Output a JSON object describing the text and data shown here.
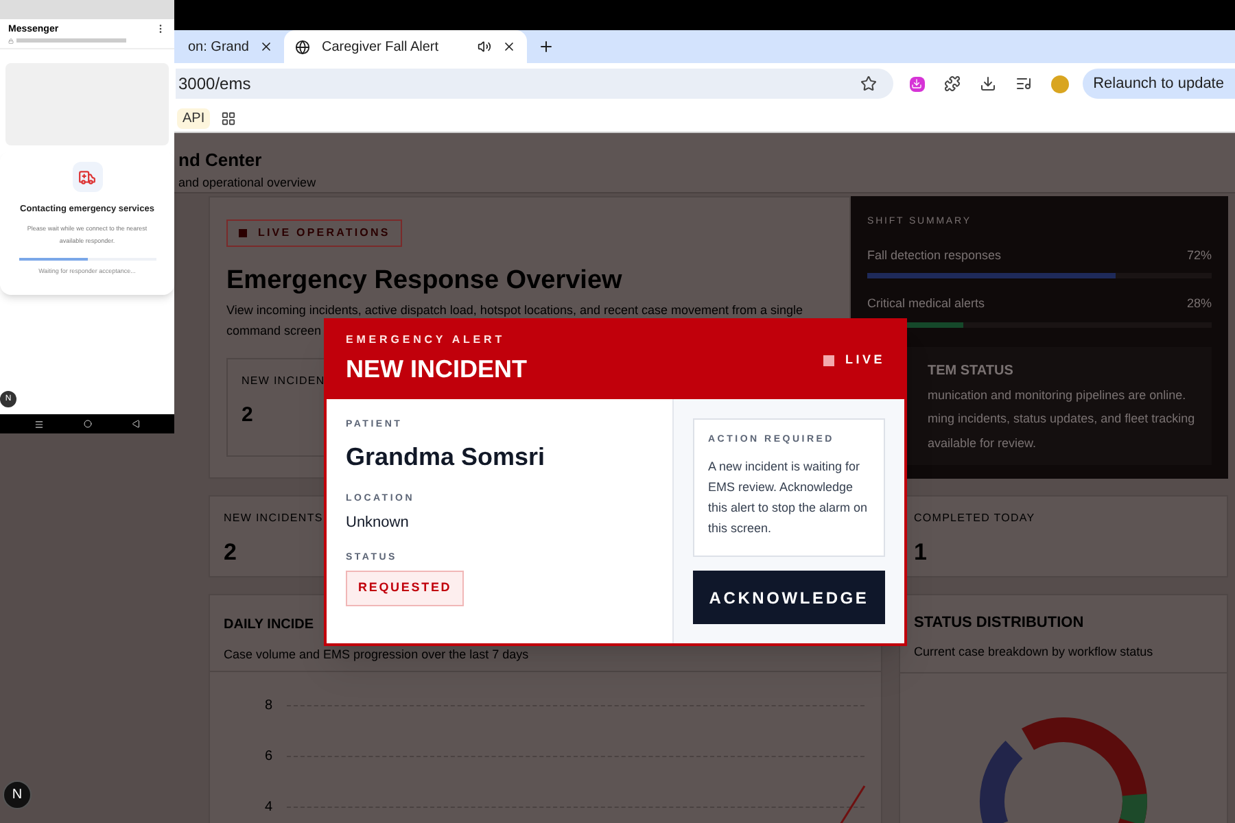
{
  "browser": {
    "tabs": [
      {
        "title": "on: Grand",
        "selected": false
      },
      {
        "title": "Caregiver Fall Alert",
        "selected": true,
        "audio": true
      }
    ],
    "address": "3000/ems",
    "bookmarks": [
      {
        "label": "API"
      }
    ],
    "relaunch": "Relaunch to update"
  },
  "page": {
    "header_title": "nd Center",
    "header_subtitle": "and operational overview",
    "hero": {
      "badge": "LIVE OPERATIONS",
      "title": "Emergency Response Overview",
      "description_lines": [
        "View incoming incidents, active dispatch load, hotspot locations, and recent case movement from a single",
        "command screen"
      ],
      "stat_label": "NEW INCIDEN",
      "stat_value": "2"
    },
    "shift_summary": {
      "title": "SHIFT SUMMARY",
      "metrics": [
        {
          "label": "Fall detection responses",
          "value": "72%",
          "level": 0.72,
          "color": "#1e2a5a"
        },
        {
          "label": "Critical medical alerts",
          "value": "28%",
          "level": 0.28,
          "color": "#15482a"
        }
      ],
      "system_title": "TEM STATUS",
      "system_lines": [
        "munication and monitoring pipelines are online.",
        "ming incidents, status updates, and fleet tracking",
        "available for review."
      ]
    },
    "stats": [
      {
        "label": "NEW INCIDENTS",
        "value": "2"
      },
      {
        "label": "COMPLETED TODAY",
        "value": "1"
      }
    ],
    "daily_chart": {
      "title": "DAILY INCIDE",
      "subtitle": "Case volume and EMS progression over the last 7 days",
      "y_ticks": [
        "8",
        "6",
        "4"
      ]
    },
    "status_chart": {
      "title": "STATUS DISTRIBUTION",
      "subtitle": "Current case breakdown by workflow status"
    }
  },
  "phone": {
    "app_title": "Messenger",
    "dialog": {
      "title": "Contacting emergency services",
      "message": "Please wait while we connect to the nearest available responder.",
      "level": 0.5,
      "status": "Waiting for responder acceptance..."
    }
  },
  "dev_badges": [
    "N",
    "N"
  ],
  "alert": {
    "eyebrow": "EMERGENCY ALERT",
    "title": "NEW INCIDENT",
    "live": "LIVE",
    "fields": [
      {
        "label": "PATIENT",
        "value": "Grandma Somsri",
        "kind": "name"
      },
      {
        "label": "LOCATION",
        "value": "Unknown",
        "kind": "text"
      },
      {
        "label": "STATUS",
        "value": "REQUESTED",
        "kind": "badge"
      }
    ],
    "action_title": "ACTION REQUIRED",
    "action_text": "A new incident is waiting for EMS review. Acknowledge this alert to stop the alarm on this screen.",
    "button": "ACKNOWLEDGE"
  }
}
